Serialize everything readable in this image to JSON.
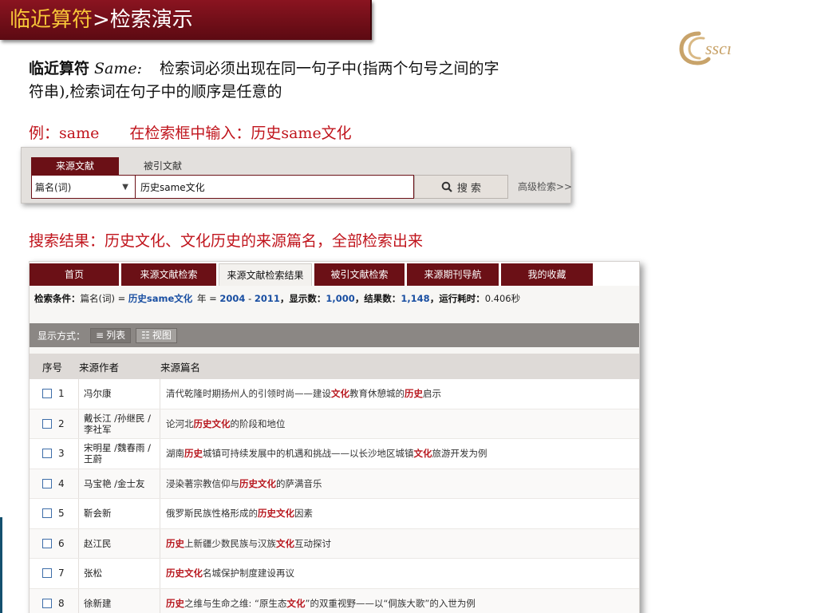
{
  "title": {
    "accent": "临近算符",
    "rest": ">检索演示"
  },
  "logo": {
    "text": "CSSCI",
    "color": "#c8a36a"
  },
  "description": {
    "keyword": "临近算符",
    "operator": "Same:",
    "line1_text": "检索词必须出现在同一句子中(指两个句号之间的字",
    "line2_text": "符串),检索词在句子中的顺序是任意的"
  },
  "example": {
    "label": "例：same",
    "instruction": "在检索框中输入：历史same文化"
  },
  "search_widget": {
    "tabs": [
      {
        "label": "来源文献",
        "active": true
      },
      {
        "label": "被引文献",
        "active": false
      }
    ],
    "field_select": "篇名(词)",
    "query": "历史same文化",
    "search_button": "搜 索",
    "advanced_link": "高级检索>>"
  },
  "result_caption": "搜索结果：历史文化、文化历史的来源篇名，全部检索出来",
  "results_panel": {
    "nav_tabs": [
      {
        "label": "首页",
        "active": false
      },
      {
        "label": "来源文献检索",
        "active": false
      },
      {
        "label": "来源文献检索结果",
        "active": true
      },
      {
        "label": "被引文献检索",
        "active": false
      },
      {
        "label": "来源期刊导航",
        "active": false
      },
      {
        "label": "我的收藏",
        "active": false
      }
    ],
    "condition": {
      "label": "检索条件：",
      "field": "篇名(词) = ",
      "query": "历史same文化",
      "year_label": "年 = ",
      "year_from": "2004",
      "year_sep": " - ",
      "year_to": "2011",
      "shown_label": "，显示数：",
      "shown": "1,000",
      "result_label": "，结果数：",
      "result": "1,148",
      "time_label": "，运行耗时：",
      "time": "0.406秒"
    },
    "view_mode": {
      "label": "显示方式：",
      "list": "列表",
      "view": "视图"
    },
    "columns": {
      "no": "序号",
      "author": "来源作者",
      "title": "来源篇名"
    },
    "rows": [
      {
        "no": "1",
        "author": "冯尔康",
        "title": [
          {
            "t": "清代乾隆时期扬州人的引领时尚——建设"
          },
          {
            "t": "文化",
            "h": true
          },
          {
            "t": "教育休憩城的"
          },
          {
            "t": "历史",
            "h": true
          },
          {
            "t": "启示"
          }
        ]
      },
      {
        "no": "2",
        "author": "戴长江 /孙继民 /李社军",
        "title": [
          {
            "t": "论河北"
          },
          {
            "t": "历史文化",
            "h": true
          },
          {
            "t": "的阶段和地位"
          }
        ]
      },
      {
        "no": "3",
        "author": "宋明星 /魏春雨 /王蔚",
        "title": [
          {
            "t": "湖南"
          },
          {
            "t": "历史",
            "h": true
          },
          {
            "t": "城镇可持续发展中的机遇和挑战——以长沙地区城镇"
          },
          {
            "t": "文化",
            "h": true
          },
          {
            "t": "旅游开发为例"
          }
        ]
      },
      {
        "no": "4",
        "author": "马宝艳 /金士友",
        "title": [
          {
            "t": "浸染著宗教信仰与"
          },
          {
            "t": "历史文化",
            "h": true
          },
          {
            "t": "的萨满音乐"
          }
        ]
      },
      {
        "no": "5",
        "author": "靳会新",
        "title": [
          {
            "t": "俄罗斯民族性格形成的"
          },
          {
            "t": "历史文化",
            "h": true
          },
          {
            "t": "因素"
          }
        ]
      },
      {
        "no": "6",
        "author": "赵江民",
        "title": [
          {
            "t": "历史",
            "h": true
          },
          {
            "t": "上新疆少数民族与汉族"
          },
          {
            "t": "文化",
            "h": true
          },
          {
            "t": "互动探讨"
          }
        ]
      },
      {
        "no": "7",
        "author": "张松",
        "title": [
          {
            "t": "历史文化",
            "h": true
          },
          {
            "t": "名城保护制度建设再议"
          }
        ]
      },
      {
        "no": "8",
        "author": "徐新建",
        "title": [
          {
            "t": "历史",
            "h": true
          },
          {
            "t": "之维与生命之维: “原生态"
          },
          {
            "t": "文化",
            "h": true
          },
          {
            "t": "”的双重视野——以“侗族大歌”的入世为例"
          }
        ]
      }
    ]
  },
  "colors": {
    "brand_red": "#6b1016",
    "highlight_red": "#c0141c",
    "title_gold": "#f7c638",
    "link_blue": "#1a4fa2"
  }
}
